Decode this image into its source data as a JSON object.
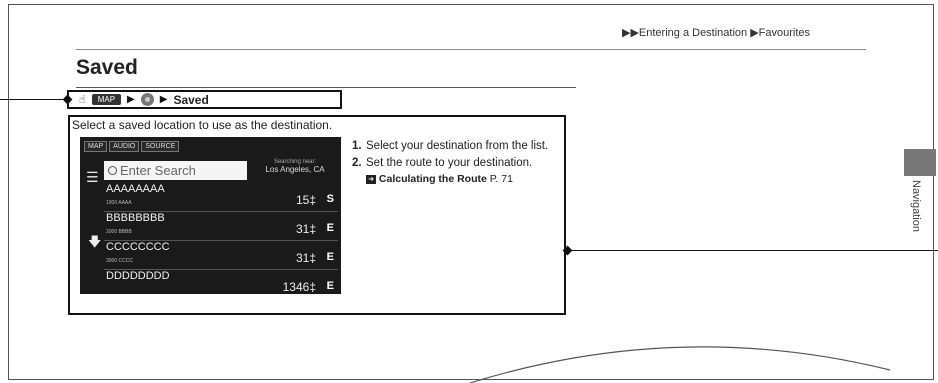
{
  "breadcrumb": "▶▶Entering a Destination ▶Favourites",
  "title": "Saved",
  "path": {
    "map_chip": "MAP",
    "sep1": "▶",
    "sep2": "▶",
    "label": "Saved"
  },
  "intro": "Select a saved location to use as the destination.",
  "screen": {
    "tabs": [
      "MAP",
      "AUDIO",
      "SOURCE"
    ],
    "search_placeholder": "Enter Search",
    "searching_near_label": "Searching near:",
    "searching_near_value": "Los Angeles, CA",
    "rows": [
      {
        "name": "AAAAAAAA",
        "address": "1000 AAAA",
        "distance": "15‡",
        "direction": "S"
      },
      {
        "name": "BBBBBBBB",
        "address": "2000 BBBB",
        "distance": "31‡",
        "direction": "E"
      },
      {
        "name": "CCCCCCCC",
        "address": "3000 CCCC",
        "distance": "31‡",
        "direction": "E"
      },
      {
        "name": "DDDDDDDD",
        "address": "",
        "distance": "1346‡",
        "direction": "E"
      }
    ]
  },
  "steps": {
    "step1_num": "1.",
    "step1_text": "Select your destination from the list.",
    "step2_num": "2.",
    "step2_text": "Set the route to your destination.",
    "link_text": "Calculating the Route",
    "link_page": "P. 71"
  },
  "side_tab_label": "Navigation",
  "icons": {
    "hand": "hand-pointer-icon",
    "home": "home-button-icon",
    "menu": "menu-icon",
    "search": "search-icon",
    "scroll": "scroll-down-icon",
    "link_arrow": "reference-arrow-icon"
  }
}
